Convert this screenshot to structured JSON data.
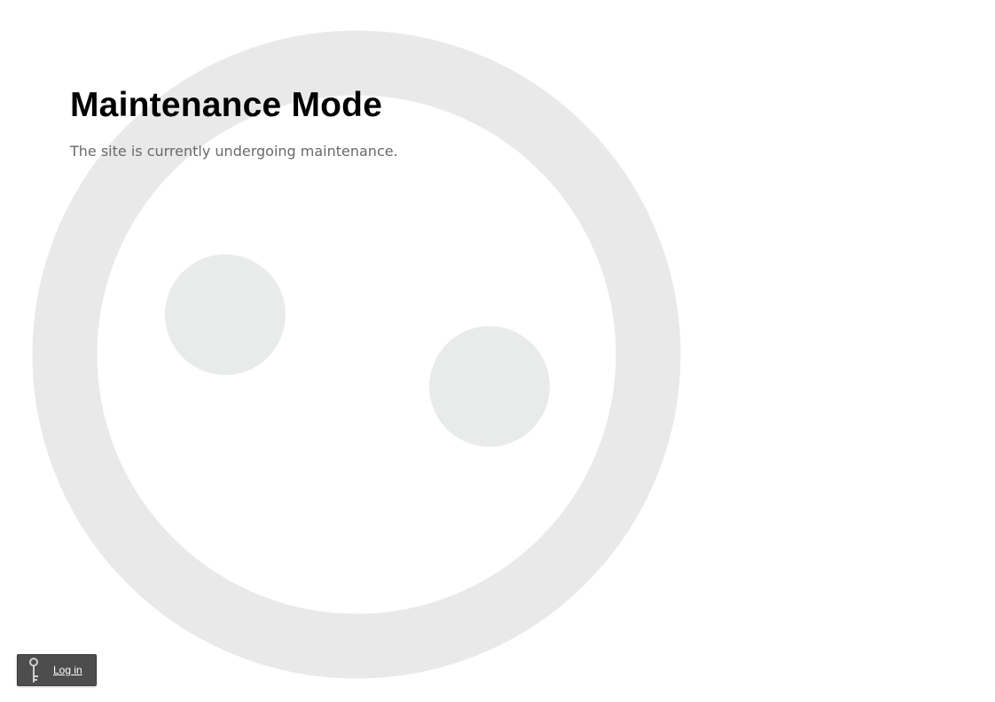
{
  "page": {
    "title": "Maintenance Mode",
    "message": "The site is currently undergoing maintenance."
  },
  "login": {
    "label": "Log in",
    "icon": "key-icon"
  },
  "background": {
    "icon": "drupal-drop-face-watermark",
    "color": "#e9eaea"
  }
}
